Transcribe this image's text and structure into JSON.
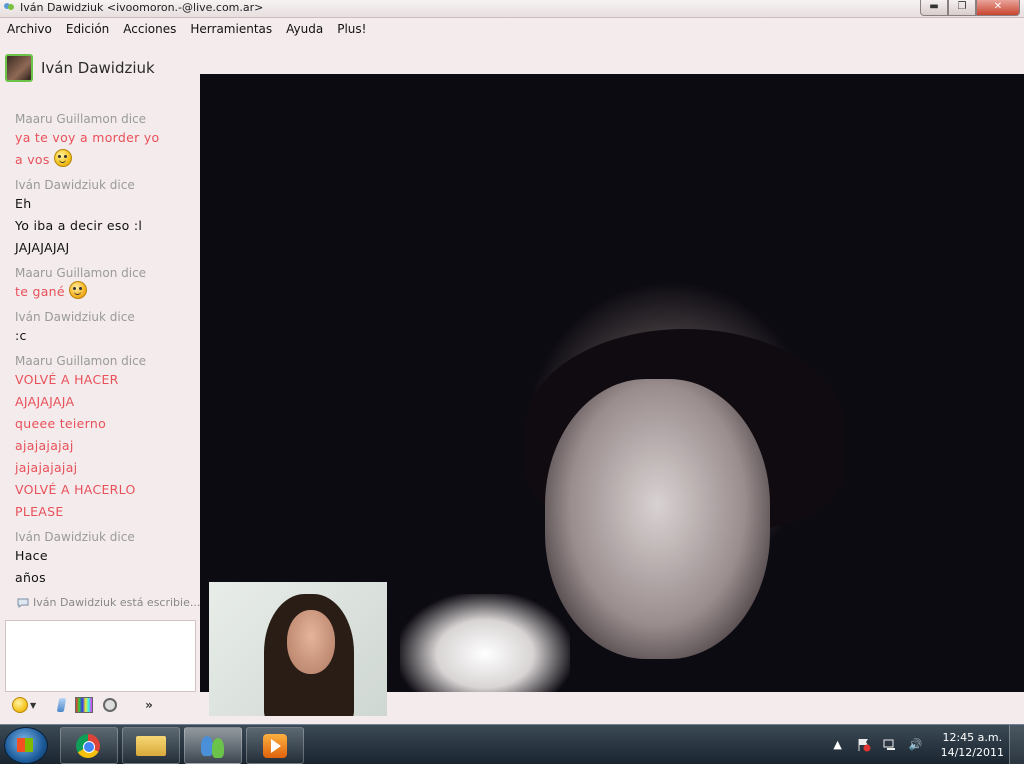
{
  "window": {
    "title": "Iván Dawidziuk <ivoomoron.-@live.com.ar>",
    "minimize_glyph": "▬",
    "maximize_glyph": "❐",
    "close_glyph": "✕"
  },
  "menu": [
    "Archivo",
    "Edición",
    "Acciones",
    "Herramientas",
    "Ayuda",
    "Plus!"
  ],
  "contact": {
    "name": "Iván Dawidziuk"
  },
  "chat": {
    "blocks": [
      {
        "sender": "Maaru Guillamon dice",
        "lines": [
          "ya te voy a morder yo",
          "a vos"
        ]
      },
      {
        "sender": "Iván Dawidziuk dice",
        "lines": [
          "Eh",
          "Yo iba a decir eso :l",
          "JAJAJAJAJ"
        ]
      },
      {
        "sender": "Maaru Guillamon dice",
        "lines": [
          "te gané"
        ]
      },
      {
        "sender": "Iván Dawidziuk dice",
        "lines": [
          ":c"
        ]
      },
      {
        "sender": "Maaru Guillamon dice",
        "lines": [
          "VOLVÉ A HACER",
          "AJAJAJAJA",
          "queee teierno",
          "ajajajajaj",
          "jajajajajaj",
          "VOLVÉ A HACERLO",
          "PLEASE"
        ]
      },
      {
        "sender": "Iván Dawidziuk dice",
        "lines": [
          "Hace",
          "años"
        ]
      }
    ],
    "typing_status": "Iván Dawidziuk está escribie...",
    "input_value": ""
  },
  "toolbar": {
    "more_label": "»"
  },
  "icons": {
    "emoticon": "smiley-icon",
    "nudge": "nudge-icon",
    "wink": "color-grid-icon",
    "voice": "voice-clip-icon"
  },
  "taskbar": {
    "apps": [
      "google-chrome",
      "windows-explorer",
      "windows-live-messenger",
      "windows-media-player"
    ],
    "tray": {
      "expand": "▲",
      "volume": "🔊"
    },
    "clock_time": "12:45 a.m.",
    "clock_date": "14/12/2011"
  },
  "colors": {
    "contact_message": "#e8505a",
    "own_message": "#111111",
    "sender_label": "#9a9a9a",
    "accent_avatar_border": "#6cc34a"
  }
}
